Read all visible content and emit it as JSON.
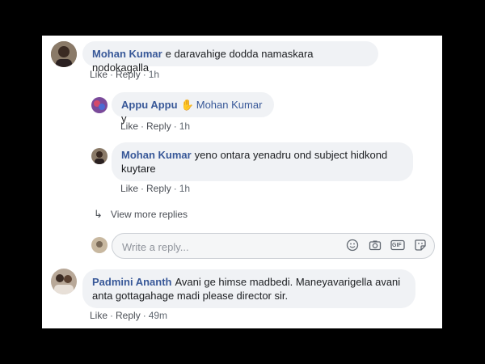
{
  "comments": [
    {
      "author": "Mohan Kumar",
      "text": "e daravahige dodda namaskara nodokagalla",
      "actions": {
        "like": "Like",
        "reply": "Reply",
        "time": "1h"
      }
    },
    {
      "author": "Appu Appu",
      "mention": "Mohan Kumar",
      "text": "y",
      "actions": {
        "like": "Like",
        "reply": "Reply",
        "time": "1h"
      }
    },
    {
      "author": "Mohan Kumar",
      "text": "yeno ontara yenadru ond subject hidkond",
      "text_line2": "kuytare",
      "actions": {
        "like": "Like",
        "reply": "Reply",
        "time": "1h"
      }
    },
    {
      "author": "Padmini Ananth",
      "text": "Avani ge himse madbedi. Maneyavarigella avani",
      "text_line2": "anta gottagahage madi please director sir.",
      "actions": {
        "like": "Like",
        "reply": "Reply",
        "time": "49m"
      }
    }
  ],
  "view_more": {
    "label": "View more replies",
    "icon": "reply-arrow-icon"
  },
  "reply_box": {
    "placeholder": "Write a reply...",
    "icons": [
      "emoji-icon",
      "camera-icon",
      "gif-icon",
      "sticker-icon"
    ],
    "gif_label": "GIF"
  },
  "separator": "·",
  "colors": {
    "name": "#385898",
    "bubble": "#f0f2f5",
    "meta": "#606770",
    "frame": "#000000"
  }
}
